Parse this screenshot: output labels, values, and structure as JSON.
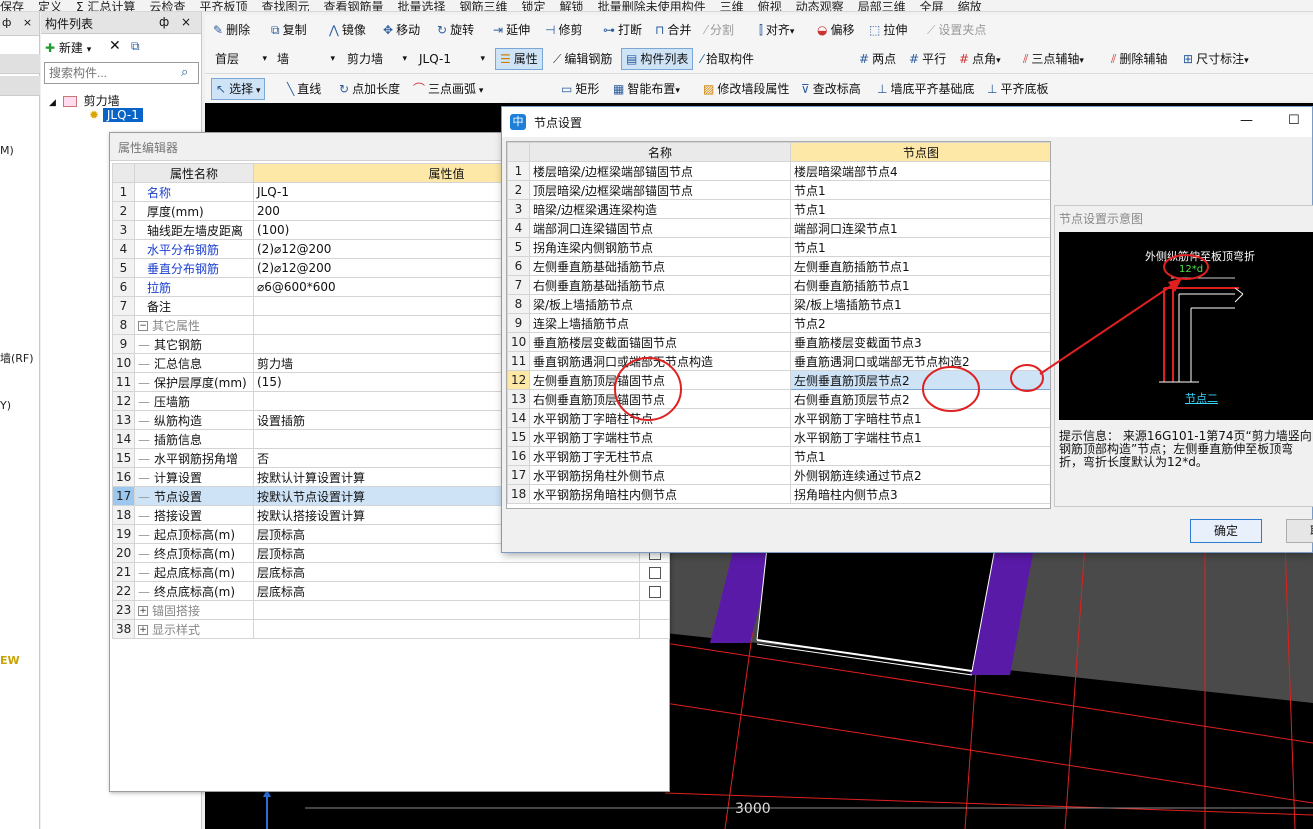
{
  "topbar": {
    "items": [
      "保存",
      "定义",
      "Σ 汇总计算",
      "云检查",
      "平齐板顶",
      "查找图元",
      "查看钢筋量",
      "批量选择",
      "钢筋三维",
      "锁定",
      "解锁",
      "批量删除未使用构件",
      "三维",
      "俯视",
      "动态观察",
      "局部三维",
      "全屏",
      "缩放"
    ]
  },
  "left_panel": {
    "pin": "ф",
    "close": "×",
    "fragments": [
      "M)",
      "墙(RF)",
      "Y)",
      "EW"
    ]
  },
  "component_list": {
    "title": "构件列表",
    "pin": "ф",
    "close": "×",
    "new_button": "新建",
    "delete_icon": "✕",
    "copy_icon": "⧉",
    "search_placeholder": "搜索构件...",
    "tree_root": "剪力墙",
    "tree_child": "JLQ-1"
  },
  "toolbar1": {
    "items": [
      "删除",
      "复制",
      "镜像",
      "移动",
      "旋转",
      "延伸",
      "修剪",
      "打断",
      "合并",
      "分割",
      "对齐",
      "偏移",
      "拉伸",
      "设置夹点"
    ]
  },
  "toolbar2": {
    "floor": "首层",
    "type": "墙",
    "subtype": "剪力墙",
    "component": "JLQ-1",
    "attr": "属性",
    "edit_rebar": "编辑钢筋",
    "comp_list": "构件列表",
    "pick": "拾取构件",
    "two_point": "两点",
    "parallel": "平行",
    "point_angle": "点角",
    "three_point_aux": "三点辅轴",
    "delete_aux": "删除辅轴",
    "dimension": "尺寸标注"
  },
  "toolbar3": {
    "select": "选择",
    "line": "直线",
    "point_length": "点加长度",
    "three_point_arc": "三点画弧",
    "rect": "矩形",
    "smart_layout": "智能布置",
    "modify_segment": "修改墙段属性",
    "check_elev": "查改标高",
    "wall_base_flush": "墙底平齐基础底",
    "flush_floor": "平齐底板"
  },
  "canvas": {
    "dimension_label": "3000"
  },
  "prop_editor": {
    "title": "属性编辑器",
    "col_name": "属性名称",
    "col_value": "属性值",
    "rows": [
      {
        "n": "1",
        "name": "名称",
        "value": "JLQ-1",
        "style": "blue",
        "chk": false
      },
      {
        "n": "2",
        "name": "厚度(mm)",
        "value": "200",
        "style": "",
        "chk": false
      },
      {
        "n": "3",
        "name": "轴线距左墙皮距离",
        "value": "(100)",
        "style": "",
        "chk": false
      },
      {
        "n": "4",
        "name": "水平分布钢筋",
        "value": "(2)⌀12@200",
        "style": "blue",
        "chk": false
      },
      {
        "n": "5",
        "name": "垂直分布钢筋",
        "value": "(2)⌀12@200",
        "style": "blue",
        "chk": false
      },
      {
        "n": "6",
        "name": "拉筋",
        "value": "⌀6@600*600",
        "style": "blue",
        "chk": false
      },
      {
        "n": "7",
        "name": "备注",
        "value": "",
        "style": "",
        "chk": false
      },
      {
        "n": "8",
        "name": "其它属性",
        "value": "",
        "style": "group",
        "chk": false,
        "pm": "−"
      },
      {
        "n": "9",
        "name": "其它钢筋",
        "value": "",
        "style": "child",
        "chk": false
      },
      {
        "n": "10",
        "name": "汇总信息",
        "value": "剪力墙",
        "style": "child",
        "chk": false
      },
      {
        "n": "11",
        "name": "保护层厚度(mm)",
        "value": "(15)",
        "style": "child",
        "chk": false
      },
      {
        "n": "12",
        "name": "压墙筋",
        "value": "",
        "style": "child",
        "chk": false
      },
      {
        "n": "13",
        "name": "纵筋构造",
        "value": "设置插筋",
        "style": "child",
        "chk": false
      },
      {
        "n": "14",
        "name": "插筋信息",
        "value": "",
        "style": "child",
        "chk": false
      },
      {
        "n": "15",
        "name": "水平钢筋拐角增",
        "value": "否",
        "style": "child",
        "chk": false
      },
      {
        "n": "16",
        "name": "计算设置",
        "value": "按默认计算设置计算",
        "style": "child",
        "chk": false
      },
      {
        "n": "17",
        "name": "节点设置",
        "value": "按默认节点设置计算",
        "style": "child-sel",
        "chk": false
      },
      {
        "n": "18",
        "name": "搭接设置",
        "value": "按默认搭接设置计算",
        "style": "child",
        "chk": false
      },
      {
        "n": "19",
        "name": "起点顶标高(m)",
        "value": "层顶标高",
        "style": "child",
        "chk": false
      },
      {
        "n": "20",
        "name": "终点顶标高(m)",
        "value": "层顶标高",
        "style": "child",
        "chk": true
      },
      {
        "n": "21",
        "name": "起点底标高(m)",
        "value": "层底标高",
        "style": "child",
        "chk": true
      },
      {
        "n": "22",
        "name": "终点底标高(m)",
        "value": "层底标高",
        "style": "child",
        "chk": true
      },
      {
        "n": "23",
        "name": "锚固搭接",
        "value": "",
        "style": "group",
        "chk": false,
        "pm": "+"
      },
      {
        "n": "38",
        "name": "显示样式",
        "value": "",
        "style": "group",
        "chk": false,
        "pm": "+"
      }
    ]
  },
  "node_dialog": {
    "title": "节点设置",
    "icon": "中",
    "minimize": "—",
    "maximize": "☐",
    "col_name": "名称",
    "col_diagram": "节点图",
    "rows": [
      {
        "n": "1",
        "name": "楼层暗梁/边框梁端部锚固节点",
        "diagram": "楼层暗梁端部节点4"
      },
      {
        "n": "2",
        "name": "顶层暗梁/边框梁端部锚固节点",
        "diagram": "节点1"
      },
      {
        "n": "3",
        "name": "暗梁/边框梁遇连梁构造",
        "diagram": "节点1"
      },
      {
        "n": "4",
        "name": "端部洞口连梁锚固节点",
        "diagram": "端部洞口连梁节点1"
      },
      {
        "n": "5",
        "name": "拐角连梁内侧钢筋节点",
        "diagram": "节点1"
      },
      {
        "n": "6",
        "name": "左侧垂直筋基础插筋节点",
        "diagram": "左侧垂直筋插筋节点1"
      },
      {
        "n": "7",
        "name": "右侧垂直筋基础插筋节点",
        "diagram": "右侧垂直筋插筋节点1"
      },
      {
        "n": "8",
        "name": "梁/板上墙插筋节点",
        "diagram": "梁/板上墙插筋节点1"
      },
      {
        "n": "9",
        "name": "连梁上墙插筋节点",
        "diagram": "节点2"
      },
      {
        "n": "10",
        "name": "垂直筋楼层变截面锚固节点",
        "diagram": "垂直筋楼层变截面节点3"
      },
      {
        "n": "11",
        "name": "垂直钢筋遇洞口或端部无节点构造",
        "diagram": "垂直筋遇洞口或端部无节点构造2"
      },
      {
        "n": "12",
        "name": "左侧垂直筋顶层锚固节点",
        "diagram": "左侧垂直筋顶层节点2",
        "selected": true
      },
      {
        "n": "13",
        "name": "右侧垂直筋顶层锚固节点",
        "diagram": "右侧垂直筋顶层节点2"
      },
      {
        "n": "14",
        "name": "水平钢筋丁字暗柱节点",
        "diagram": "水平钢筋丁字暗柱节点1"
      },
      {
        "n": "15",
        "name": "水平钢筋丁字端柱节点",
        "diagram": "水平钢筋丁字端柱节点1"
      },
      {
        "n": "16",
        "name": "水平钢筋丁字无柱节点",
        "diagram": "节点1"
      },
      {
        "n": "17",
        "name": "水平钢筋拐角柱外侧节点",
        "diagram": "外侧钢筋连续通过节点2"
      },
      {
        "n": "18",
        "name": "水平钢筋拐角暗柱内侧节点",
        "diagram": "拐角暗柱内侧节点3"
      }
    ],
    "preview": {
      "title": "节点设置示意图",
      "caption": "外侧纵筋伸至板顶弯折",
      "dim": "12*d",
      "node_label": "节点二",
      "hint": "提示信息： 来源16G101-1第74页“剪力墙竖向钢筋顶部构造”节点；左侧垂直筋伸至板顶弯折，弯折长度默认为12*d。"
    },
    "ok": "确定",
    "cancel": "取消"
  },
  "colors": {
    "selection": "#cfe3f7",
    "property_blue": "#1a3fd0",
    "annotation_red": "#e02020",
    "wall_purple": "#5a1aa8"
  }
}
